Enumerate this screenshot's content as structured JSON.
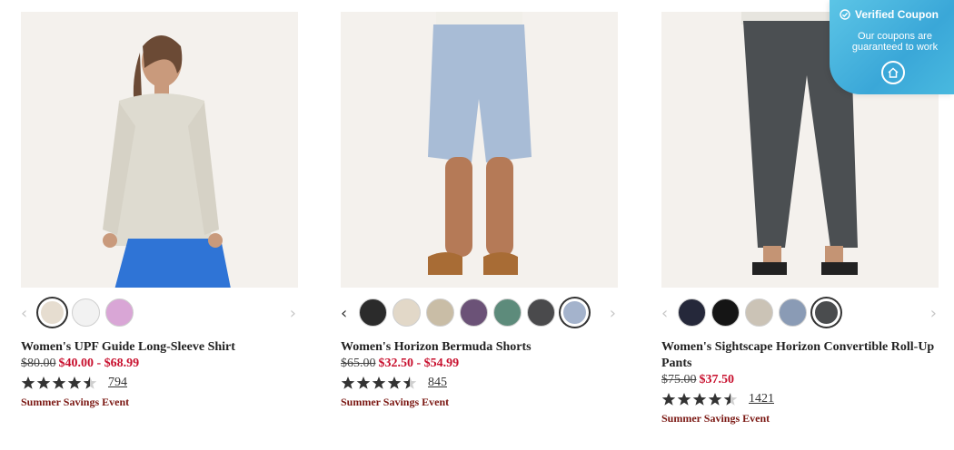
{
  "products": [
    {
      "name": "Women's UPF Guide Long-Sleeve Shirt",
      "price_old": "$80.00",
      "price_new": "$40.00 - $68.99",
      "rating": 4.5,
      "reviews": "794",
      "promo": "Summer Savings Event",
      "image": "woman-in-beige-shirt-and-blue-skirt",
      "prev_enabled": false,
      "next_enabled": false,
      "swatches": [
        {
          "color": "#e6ddd0",
          "selected": true
        },
        {
          "color": "#f2f2f2",
          "selected": false
        },
        {
          "color": "#d9a6d6",
          "selected": false
        }
      ]
    },
    {
      "name": "Women's Horizon Bermuda Shorts",
      "price_old": "$65.00",
      "price_new": "$32.50 - $54.99",
      "rating": 4.5,
      "reviews": "845",
      "promo": "Summer Savings Event",
      "image": "legs-in-light-blue-bermuda-shorts",
      "prev_enabled": true,
      "next_enabled": false,
      "swatches": [
        {
          "color": "#2b2b2b",
          "selected": false
        },
        {
          "color": "#e2d8c8",
          "selected": false
        },
        {
          "color": "#c9bda6",
          "selected": false
        },
        {
          "color": "#6b5277",
          "selected": false
        },
        {
          "color": "#5d8b7b",
          "selected": false
        },
        {
          "color": "#4a4a4c",
          "selected": false
        },
        {
          "color": "#a4b3cc",
          "selected": true
        }
      ]
    },
    {
      "name": "Women's Sightscape Horizon Convertible Roll-Up Pants",
      "price_old": "$75.00",
      "price_new": "$37.50",
      "rating": 4.5,
      "reviews": "1421",
      "promo": "Summer Savings Event",
      "image": "legs-in-charcoal-roll-up-pants",
      "prev_enabled": false,
      "next_enabled": false,
      "swatches": [
        {
          "color": "#25283a",
          "selected": false
        },
        {
          "color": "#151515",
          "selected": false
        },
        {
          "color": "#cbc3b6",
          "selected": false
        },
        {
          "color": "#8a9bb5",
          "selected": false
        },
        {
          "color": "#4a4c4e",
          "selected": true
        }
      ]
    }
  ],
  "coupon": {
    "title": "Verified Coupon",
    "subtitle": "Our coupons are guaranteed to work",
    "icon": "home-icon",
    "check_icon": "check-circle-icon"
  },
  "icons": {
    "prev": "chevron-left-icon",
    "next": "chevron-right-icon",
    "prev_glyph": "‹",
    "next_glyph": "›"
  }
}
